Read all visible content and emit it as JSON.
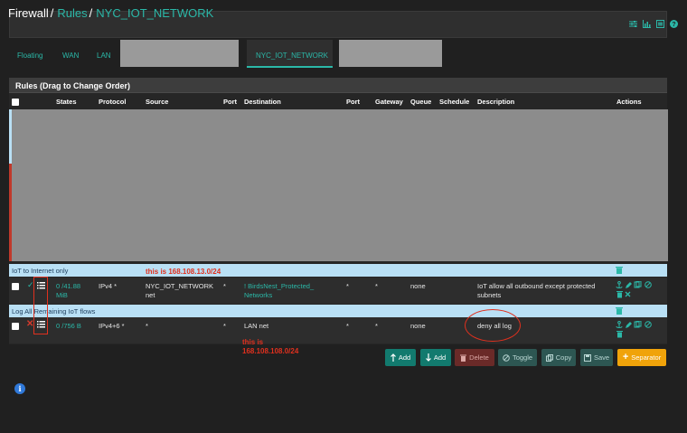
{
  "breadcrumb": {
    "firewall": "Firewall",
    "rules": "Rules",
    "network": "NYC_IOT_NETWORK",
    "sep": "/"
  },
  "header_icons": [
    "sliders-icon",
    "chart-icon",
    "list-icon",
    "help-icon"
  ],
  "tabs": {
    "floating": "Floating",
    "wan": "WAN",
    "lan": "LAN",
    "active": "NYC_IOT_NETWORK"
  },
  "panel": {
    "title": "Rules (Drag to Change Order)"
  },
  "table": {
    "columns": {
      "states": "States",
      "protocol": "Protocol",
      "source": "Source",
      "port": "Port",
      "destination": "Destination",
      "port2": "Port",
      "gateway": "Gateway",
      "queue": "Queue",
      "schedule": "Schedule",
      "description": "Description",
      "actions": "Actions"
    },
    "separator1": "IoT to Internet only",
    "row1": {
      "states_line1": "0 /41.88",
      "states_line2": "MiB",
      "protocol": "IPv4 *",
      "source_line1": "NYC_IOT_NETWORK",
      "source_line2": "net",
      "port": "*",
      "destination_line1": "! BirdsNest_Protected_",
      "destination_line2": "Networks",
      "port2": "*",
      "gateway": "*",
      "queue": "none",
      "description_line1": "IoT allow all outbound except protected",
      "description_line2": "subnets"
    },
    "separator2": "Log All Remaining IoT flows",
    "row2": {
      "states": "0 /756 B",
      "protocol": "IPv4+6 *",
      "source": "*",
      "port": "*",
      "destination": "LAN net",
      "port2": "*",
      "gateway": "*",
      "queue": "none",
      "description": "deny all log"
    }
  },
  "annotations": {
    "source_note": "this is 168.108.13.0/24",
    "dest_note_line1": "this is",
    "dest_note_line2": "168.108.108.0/24"
  },
  "buttons": {
    "add_top": "Add",
    "add_bottom": "Add",
    "delete": "Delete",
    "toggle": "Toggle",
    "copy": "Copy",
    "save": "Save",
    "separator": "Separator"
  },
  "colors": {
    "accent": "#2bb8a8",
    "separator_row": "#b9e0f5",
    "annotation": "#e0301e",
    "separator_button": "#f0a30a"
  }
}
